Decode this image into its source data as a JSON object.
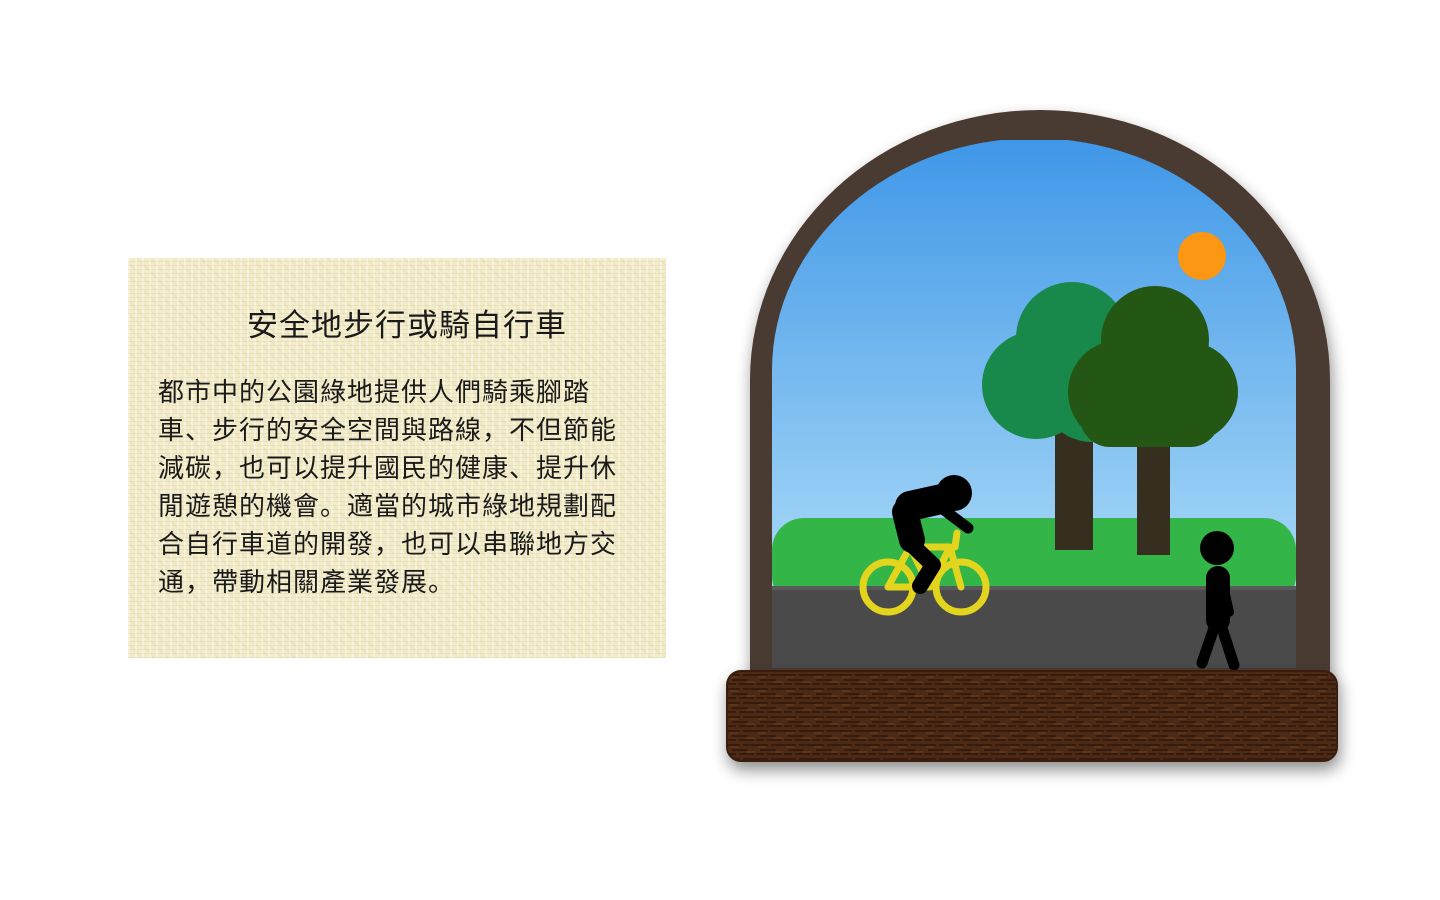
{
  "info_card": {
    "title": "安全地步行或騎自行車",
    "body": "都市中的公園綠地提供人們騎乘腳踏車、步行的安全空間與路線，不但節能減碳，也可以提升國民的健康、提升休閒遊憩的機會。適當的城市綠地規劃配合自行車道的開發，也可以串聯地方交通，帶動相關產業發展。"
  },
  "colors": {
    "page_background": "#ffffff",
    "card_background": "#f3ecc9",
    "arch_frame": "#4a3b30",
    "sky_top": "#3f97e8",
    "sky_bottom": "#bfe7fa",
    "sun": "#fb9712",
    "grass": "#33b547",
    "road": "#4a4a4a",
    "bicycle": "#e3d51d",
    "tree_light": "#18894a",
    "tree_dark": "#245614",
    "trunk": "#362f1f",
    "base": "#4e2a12"
  },
  "icons": [
    "sun-icon",
    "tree-icon",
    "cyclist-icon",
    "bicycle-icon",
    "pedestrian-icon"
  ]
}
